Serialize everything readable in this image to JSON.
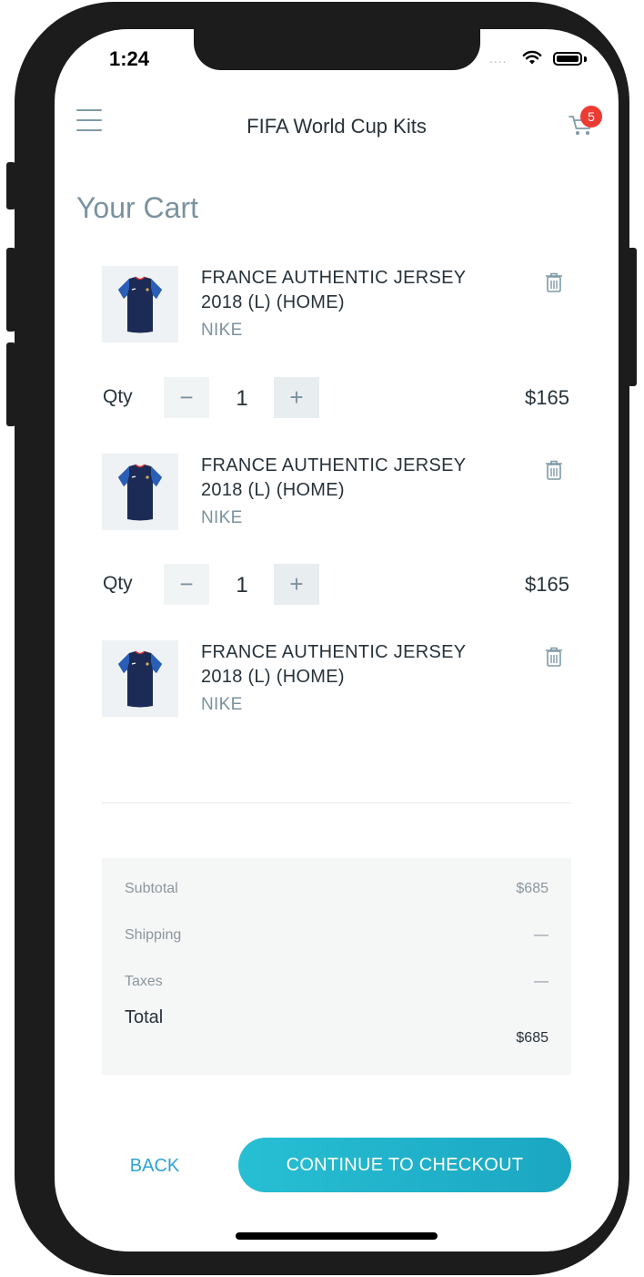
{
  "status_bar": {
    "time": "1:24",
    "signal": "....",
    "wifi_icon": "wifi-icon",
    "battery_icon": "battery-icon"
  },
  "header": {
    "title": "FIFA World Cup Kits",
    "menu_icon": "hamburger-icon",
    "cart_icon": "cart-icon",
    "cart_count": "5"
  },
  "page": {
    "title": "Your Cart"
  },
  "items": [
    {
      "name": "FRANCE AUTHENTIC JERSEY 2018 (L) (HOME)",
      "brand": "NIKE",
      "qty_label": "Qty",
      "qty": "1",
      "minus": "−",
      "plus": "+",
      "price": "$165"
    },
    {
      "name": "FRANCE AUTHENTIC JERSEY 2018 (L) (HOME)",
      "brand": "NIKE",
      "qty_label": "Qty",
      "qty": "1",
      "minus": "−",
      "plus": "+",
      "price": "$165"
    },
    {
      "name": "FRANCE AUTHENTIC JERSEY 2018 (L) (HOME)",
      "brand": "NIKE"
    }
  ],
  "summary": {
    "subtotal_label": "Subtotal",
    "subtotal_value": "$685",
    "shipping_label": "Shipping",
    "shipping_value": "—",
    "taxes_label": "Taxes",
    "taxes_value": "—",
    "total_label": "Total",
    "total_value": "$685"
  },
  "actions": {
    "back": "BACK",
    "checkout": "CONTINUE TO CHECKOUT"
  },
  "colors": {
    "accent": "#27bfd3",
    "link": "#2ea3d6",
    "badge": "#ec3b33",
    "jersey": "#1b2b55"
  }
}
